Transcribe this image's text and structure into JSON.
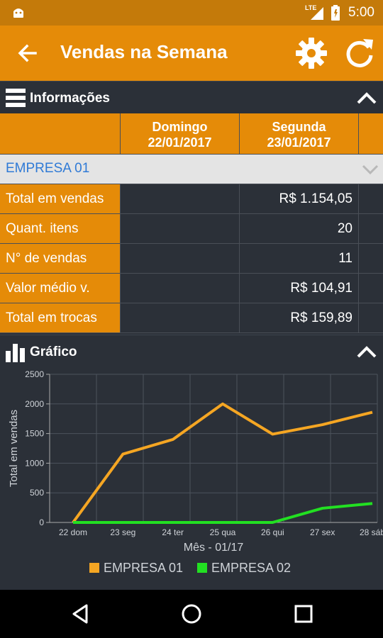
{
  "status_bar": {
    "time": "5:00",
    "network": "LTE"
  },
  "app_bar": {
    "title": "Vendas na Semana"
  },
  "info_section": {
    "title": "Informações"
  },
  "table": {
    "columns": [
      {
        "day": "Domingo",
        "date": "22/01/2017"
      },
      {
        "day": "Segunda",
        "date": "23/01/2017"
      }
    ],
    "company": "EMPRESA 01",
    "rows": [
      {
        "label": "Total em vendas",
        "values": [
          "",
          "R$ 1.154,05"
        ]
      },
      {
        "label": "Quant. itens",
        "values": [
          "",
          "20"
        ]
      },
      {
        "label": "N° de vendas",
        "values": [
          "",
          "11"
        ]
      },
      {
        "label": "Valor médio v.",
        "values": [
          "",
          "R$ 104,91"
        ]
      },
      {
        "label": "Total em trocas",
        "values": [
          "",
          "R$ 159,89"
        ]
      }
    ]
  },
  "chart_section": {
    "title": "Gráfico"
  },
  "chart_data": {
    "type": "line",
    "categories": [
      "22 dom",
      "23 seg",
      "24 ter",
      "25 qua",
      "26 qui",
      "27 sex",
      "28 sáb"
    ],
    "series": [
      {
        "name": "EMPRESA 01",
        "color": "#f5a623",
        "values": [
          0,
          1154,
          1400,
          2000,
          1490,
          1650,
          1860
        ]
      },
      {
        "name": "EMPRESA 02",
        "color": "#22e022",
        "values": [
          0,
          0,
          0,
          0,
          0,
          240,
          320
        ]
      }
    ],
    "xlabel": "Mês - 01/17",
    "ylabel": "Total em vendas",
    "ylim": [
      0,
      2500
    ],
    "yticks": [
      0,
      500,
      1000,
      1500,
      2000,
      2500
    ],
    "grid": true,
    "legend": "bottom"
  }
}
